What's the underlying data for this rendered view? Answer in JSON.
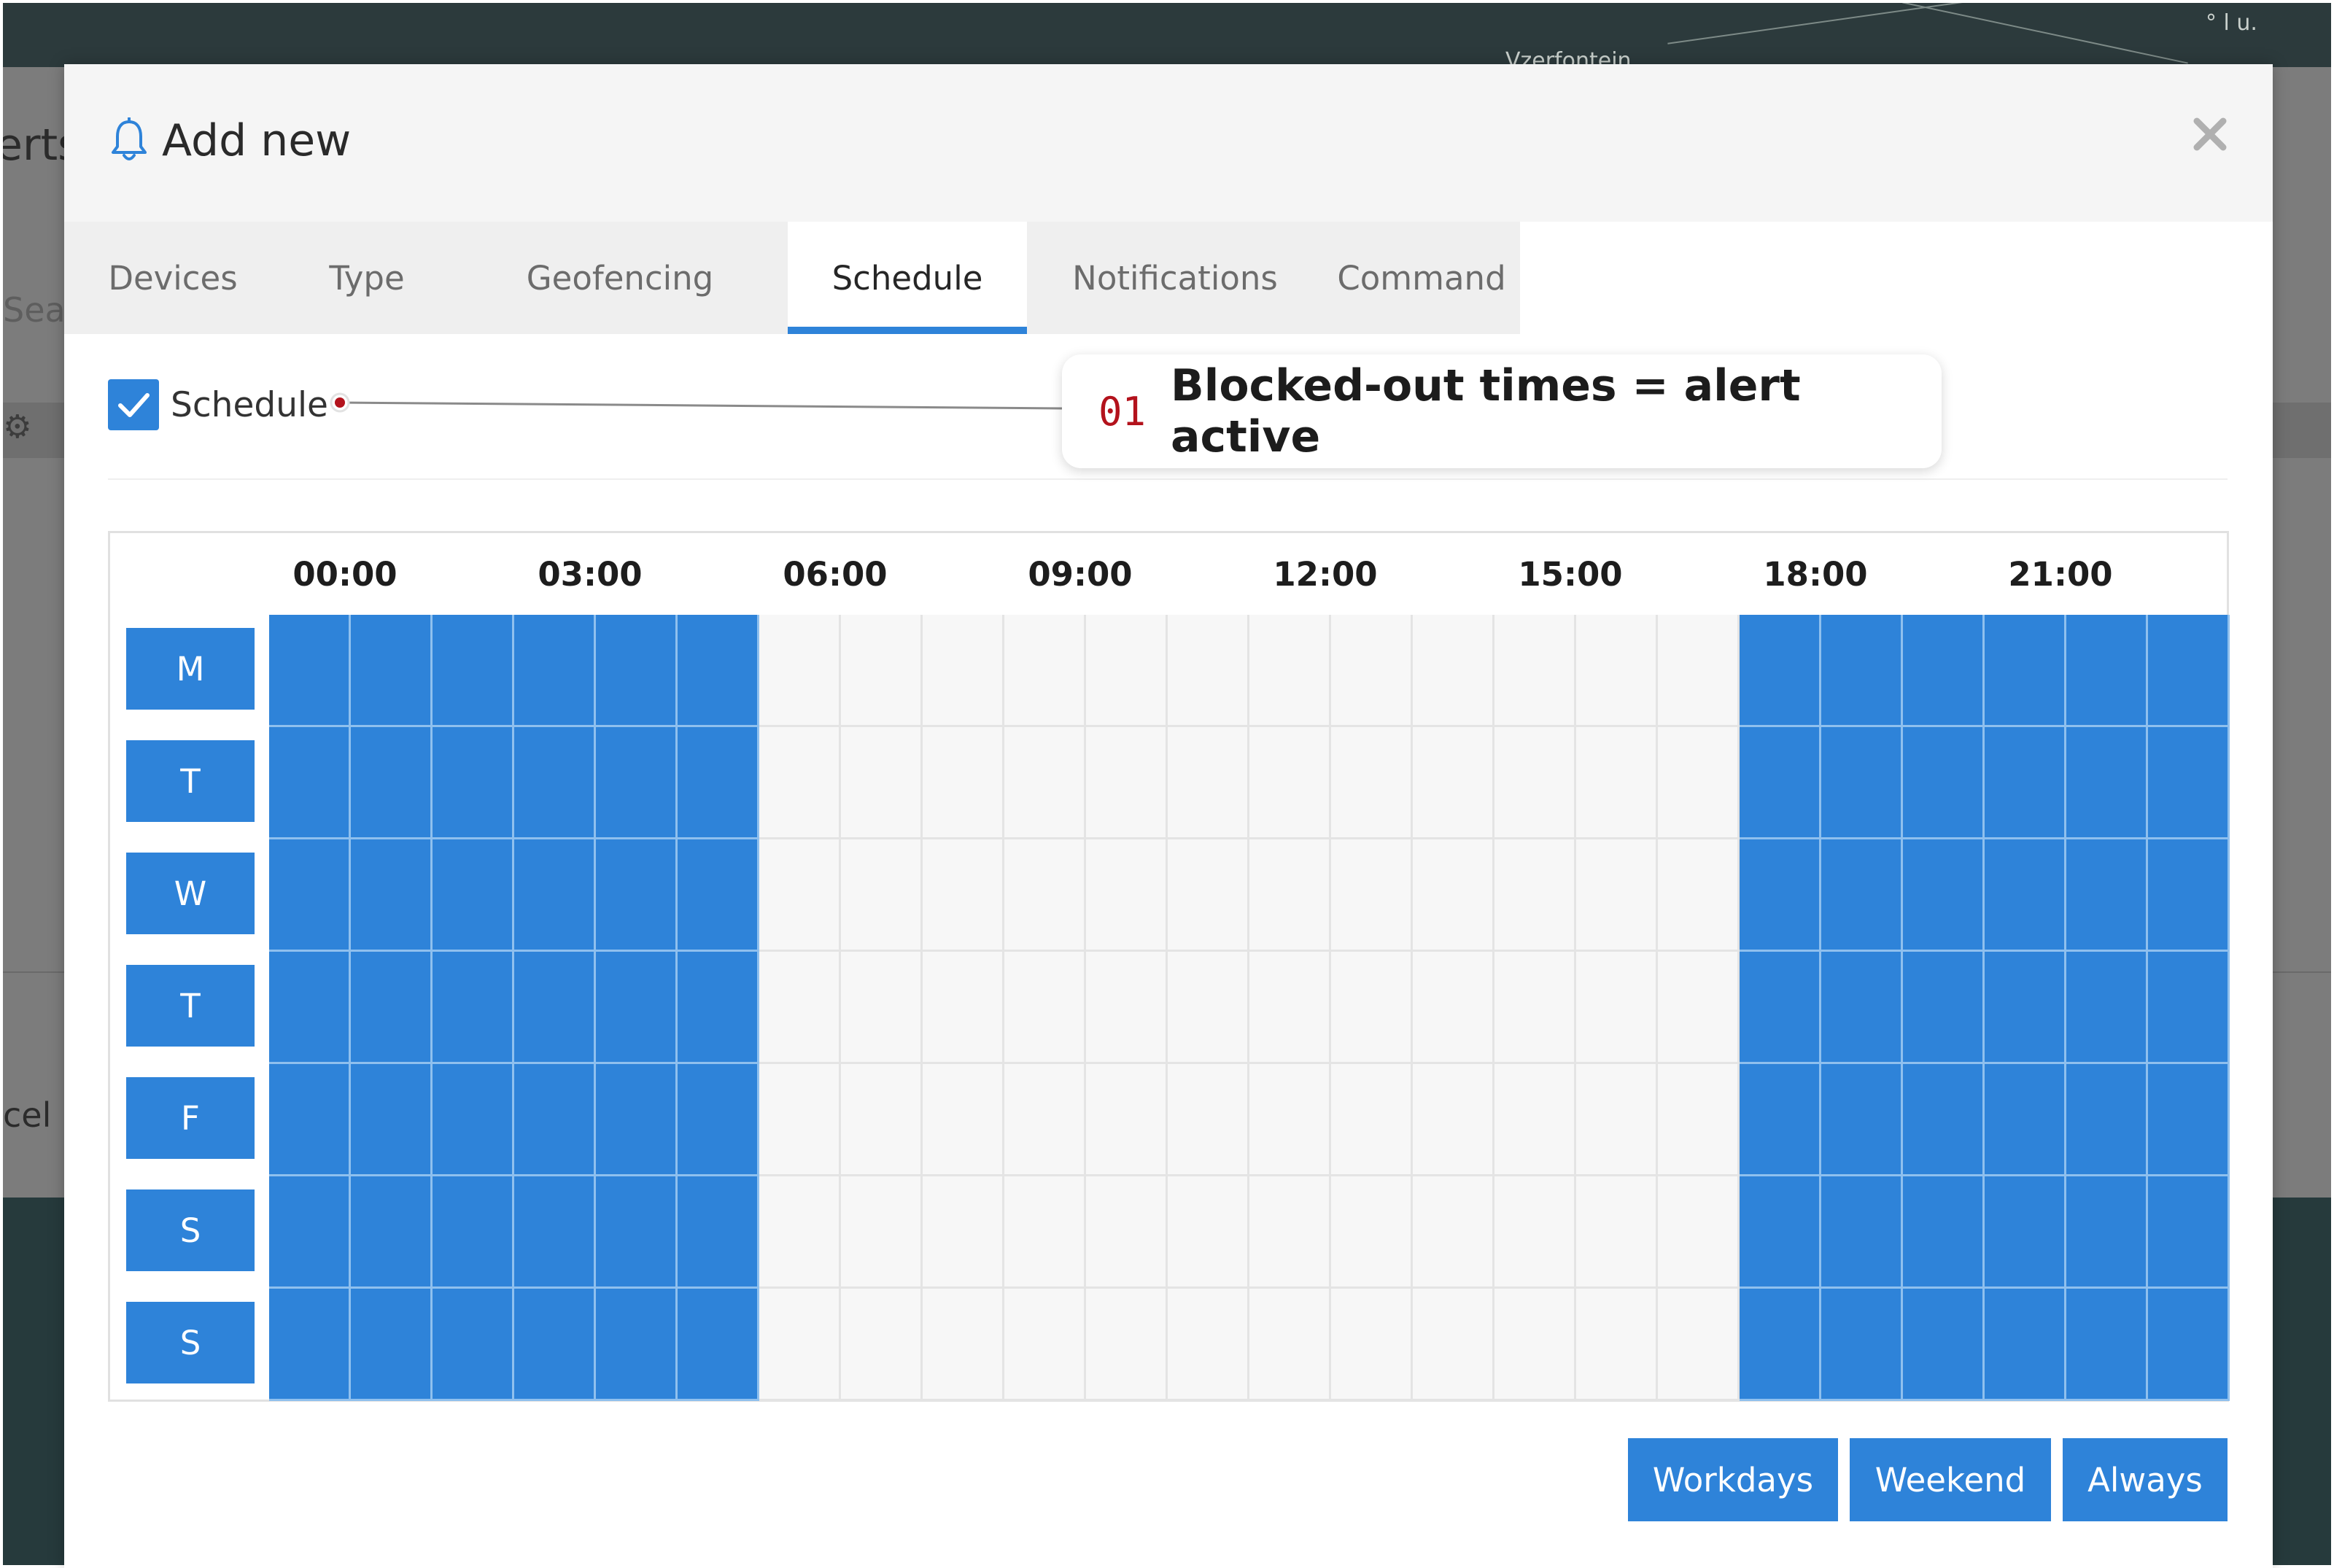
{
  "background": {
    "map_label": "Vzerfontein",
    "map_corner_text": "° l u.",
    "partial_heading": "erts",
    "partial_search": "Sear",
    "partial_cancel": "cel"
  },
  "modal": {
    "title": "Add new",
    "tabs": [
      {
        "label": "Devices",
        "active": false
      },
      {
        "label": "Type",
        "active": false
      },
      {
        "label": "Geofencing",
        "active": false
      },
      {
        "label": "Schedule",
        "active": true
      },
      {
        "label": "Notifications",
        "active": false
      },
      {
        "label": "Command",
        "active": false
      }
    ]
  },
  "schedule": {
    "enabled": true,
    "toggle_label": "Schedule",
    "hour_labels": [
      "00:00",
      "03:00",
      "06:00",
      "09:00",
      "12:00",
      "15:00",
      "18:00",
      "21:00"
    ],
    "days": [
      "M",
      "T",
      "W",
      "T",
      "F",
      "S",
      "S"
    ],
    "active_hours": [
      0,
      1,
      2,
      3,
      4,
      5,
      18,
      19,
      20,
      21,
      22,
      23
    ],
    "presets": [
      "Workdays",
      "Weekend",
      "Always"
    ]
  },
  "annotation": {
    "number": "01",
    "text": "Blocked-out times = alert active"
  },
  "colors": {
    "accent": "#2e83d9",
    "callout_number": "#b3121c"
  }
}
